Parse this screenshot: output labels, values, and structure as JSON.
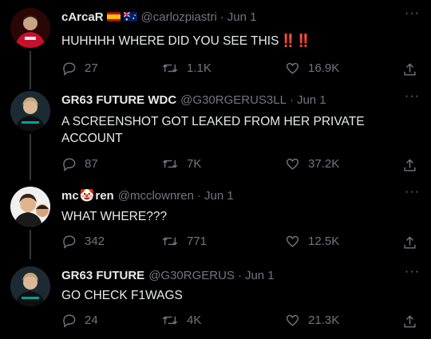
{
  "tweets": [
    {
      "name": "cArcaR",
      "name_suffix": "",
      "handle": "@carlozpiastri",
      "date": "Jun 1",
      "text": "HUHHHH WHERE DID YOU SEE THIS",
      "text_emoji": "‼️‼️",
      "replies": "27",
      "retweets": "1.1K",
      "likes": "16.9K",
      "avatar_icon": "red-racing-suit-avatar",
      "colors": {
        "avatar_bg": "#3b0a0a",
        "avatar_fg": "#c8102e"
      }
    },
    {
      "name": "GR63 FUTURE WDC",
      "name_suffix": "",
      "handle": "@G30RGERUS3LL",
      "date": "Jun 1",
      "text": "A SCREENSHOT GOT LEAKED FROM HER PRIVATE ACCOUNT",
      "replies": "87",
      "retweets": "7K",
      "likes": "37.2K",
      "avatar_icon": "mercedes-driver-avatar",
      "colors": {
        "avatar_bg": "#1a2a30",
        "avatar_fg": "#00a19b"
      }
    },
    {
      "name": "mc",
      "name_emoji": "🤡",
      "name_suffix": "ren",
      "handle": "@mcclownren",
      "date": "Jun 1",
      "text": "WHAT WHERE???",
      "replies": "342",
      "retweets": "771",
      "likes": "12.5K",
      "avatar_icon": "papaya-driver-avatar",
      "colors": {
        "avatar_bg": "#2a2a2a",
        "avatar_fg": "#d4a373"
      }
    },
    {
      "name": "GR63 FUTURE",
      "name_suffix": "",
      "handle": "@G30RGERUS",
      "date": "Jun 1",
      "text": "GO CHECK F1WAGS",
      "replies": "24",
      "retweets": "4K",
      "likes": "21.3K",
      "avatar_icon": "mercedes-driver-avatar",
      "colors": {
        "avatar_bg": "#1a2a30",
        "avatar_fg": "#00a19b"
      }
    }
  ],
  "separator": "·",
  "more_label": "···",
  "colors": {
    "background": "#000000",
    "text": "#e7e9ea",
    "muted": "#71767b",
    "line": "#333639"
  }
}
